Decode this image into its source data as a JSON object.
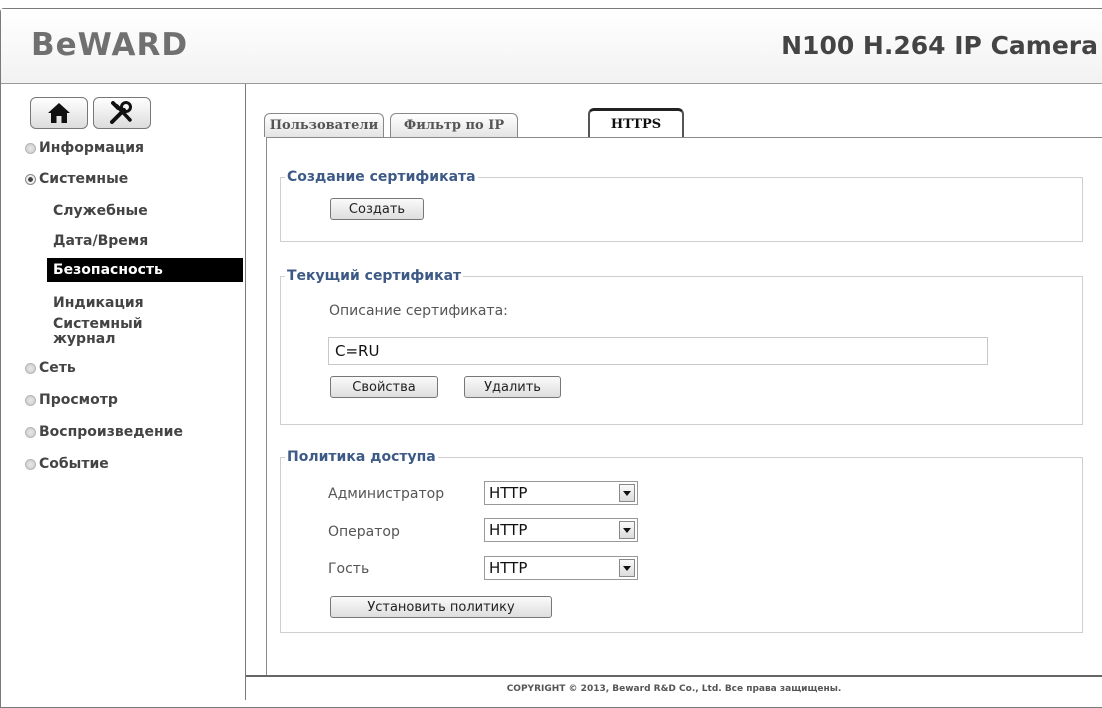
{
  "header": {
    "logo": "BeWARD",
    "model": "N100 H.264 IP Camera"
  },
  "toolbar": {
    "home_icon": "home-icon",
    "settings_icon": "tools-icon"
  },
  "nav": {
    "info": "Информация",
    "system": "Системные",
    "system_items": [
      "Служебные",
      "Дата/Время",
      "Безопасность",
      "Индикация",
      "Системный журнал"
    ],
    "network": "Сеть",
    "view": "Просмотр",
    "playback": "Воспроизведение",
    "event": "Событие"
  },
  "tabs": [
    "Пользователи",
    "Фильтр по IP",
    "HTTPS"
  ],
  "create_cert": {
    "legend": "Создание сертификата",
    "create_button": "Создать"
  },
  "current_cert": {
    "legend": "Текущий сертификат",
    "desc_label": "Описание сертификата:",
    "desc_value": "C=RU",
    "props_button": "Свойства",
    "delete_button": "Удалить"
  },
  "policy": {
    "legend": "Политика доступа",
    "rows": [
      {
        "label": "Администратор",
        "value": "HTTP"
      },
      {
        "label": "Оператор",
        "value": "HTTP"
      },
      {
        "label": "Гость",
        "value": "HTTP"
      }
    ],
    "apply_button": "Установить политику"
  },
  "footer": "COPYRIGHT © 2013, Beward R&D Co., Ltd. Все права защищены."
}
